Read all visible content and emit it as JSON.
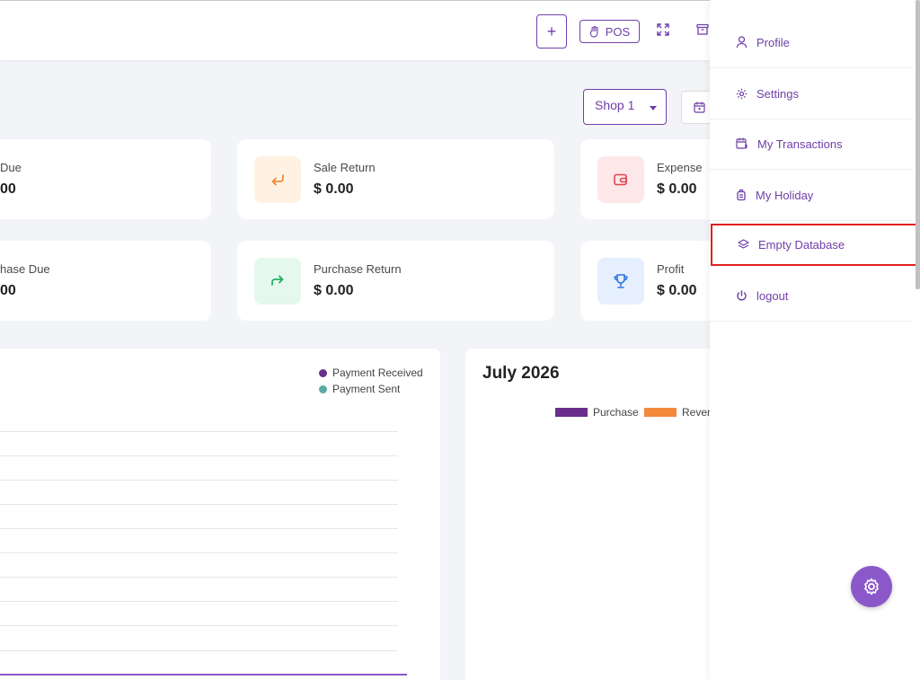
{
  "header": {
    "plus_label": "+",
    "pos_label": "POS"
  },
  "filter": {
    "shop_selected": "Shop 1"
  },
  "stats_row1": [
    {
      "label": "Due",
      "value": "00"
    },
    {
      "label": "Sale Return",
      "value": "$ 0.00",
      "icon": "return-arrow-icon",
      "icon_color": "#f28a3c",
      "icon_bg": "#fff2e3"
    },
    {
      "label": "Expense",
      "value": "$ 0.00",
      "icon": "wallet-icon",
      "icon_color": "#e0464e",
      "icon_bg": "#fde7e8"
    }
  ],
  "stats_row2": [
    {
      "label": "hase Due",
      "value": "00"
    },
    {
      "label": "Purchase Return",
      "value": "$ 0.00",
      "icon": "forward-arrow-icon",
      "icon_color": "#27ae60",
      "icon_bg": "#e5f8ee"
    },
    {
      "label": "Profit",
      "value": "$ 0.00",
      "icon": "trophy-icon",
      "icon_color": "#2f6fe0",
      "icon_bg": "#e6effd"
    }
  ],
  "payment_chart": {
    "legend": [
      {
        "name": "Payment Received",
        "color": "#6a2e8c"
      },
      {
        "name": "Payment Sent",
        "color": "#5aa9a4"
      }
    ]
  },
  "monthly_chart": {
    "title": "July 2026",
    "legend": [
      {
        "name": "Purchase",
        "color": "#6a2e8c"
      },
      {
        "name": "Reven",
        "color": "#f28a3c"
      }
    ]
  },
  "dropdown": {
    "items": [
      {
        "label": "Profile",
        "icon": "user-icon"
      },
      {
        "label": "Settings",
        "icon": "gear-icon"
      },
      {
        "label": "My Transactions",
        "icon": "calendar-dollar-icon"
      },
      {
        "label": "My Holiday",
        "icon": "suitcase-icon"
      },
      {
        "label": "Empty Database",
        "icon": "layers-icon"
      },
      {
        "label": "logout",
        "icon": "power-icon"
      }
    ]
  },
  "colors": {
    "accent": "#6f3fa8",
    "highlight_border": "#e0201e",
    "fab": "#8b58c9"
  }
}
